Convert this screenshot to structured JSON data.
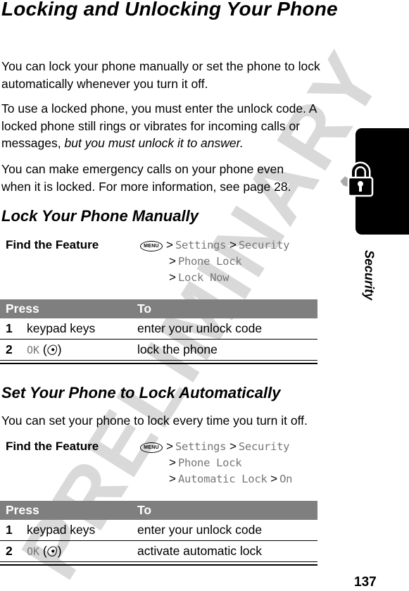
{
  "page": {
    "title": "Locking and Unlocking Your Phone",
    "intro_paragraphs": [
      "You can lock your phone manually or set the phone to lock automatically whenever you turn it off."
    ],
    "para2_plain": "To use a locked phone, you must enter the unlock code. A locked phone still rings or vibrates for incoming calls or messages, ",
    "para2_italic": "but you must unlock it to answer.",
    "para3": "You can make emergency calls on your phone even when it is locked. For more information, see page 28.",
    "watermark": "PRELIMINARY",
    "page_number": "137",
    "section_tab": {
      "label": "Security",
      "icon": "padlock-with-key-icon"
    }
  },
  "manual": {
    "heading": "Lock Your Phone Manually",
    "find_feature": {
      "label": "Find the Feature",
      "menu_key": "MENU",
      "separator": ">",
      "path": [
        "Settings",
        "Security",
        "Phone Lock",
        "Lock Now"
      ]
    },
    "table": {
      "headers": [
        "Press",
        "To"
      ],
      "rows": [
        {
          "num": "1",
          "press": "keypad keys",
          "to": "enter your unlock code"
        },
        {
          "num": "2",
          "press": "OK",
          "press_key_icon": "center-select-key-icon",
          "to": "lock the phone"
        }
      ]
    }
  },
  "automatic": {
    "heading": "Set Your Phone to Lock Automatically",
    "description": "You can set your phone to lock every time you turn it off.",
    "find_feature": {
      "label": "Find the Feature",
      "menu_key": "MENU",
      "separator": ">",
      "path": [
        "Settings",
        "Security",
        "Phone Lock",
        "Automatic Lock",
        "On"
      ]
    },
    "table": {
      "headers": [
        "Press",
        "To"
      ],
      "rows": [
        {
          "num": "1",
          "press": "keypad keys",
          "to": "enter your unlock code"
        },
        {
          "num": "2",
          "press": "OK",
          "press_key_icon": "center-select-key-icon",
          "to": "activate automatic lock"
        }
      ]
    }
  },
  "colors": {
    "table_header_bg": "#7f7f7f",
    "menu_path_text": "#777777",
    "watermark": "#d9d9d9",
    "side_tab": "#000000"
  }
}
